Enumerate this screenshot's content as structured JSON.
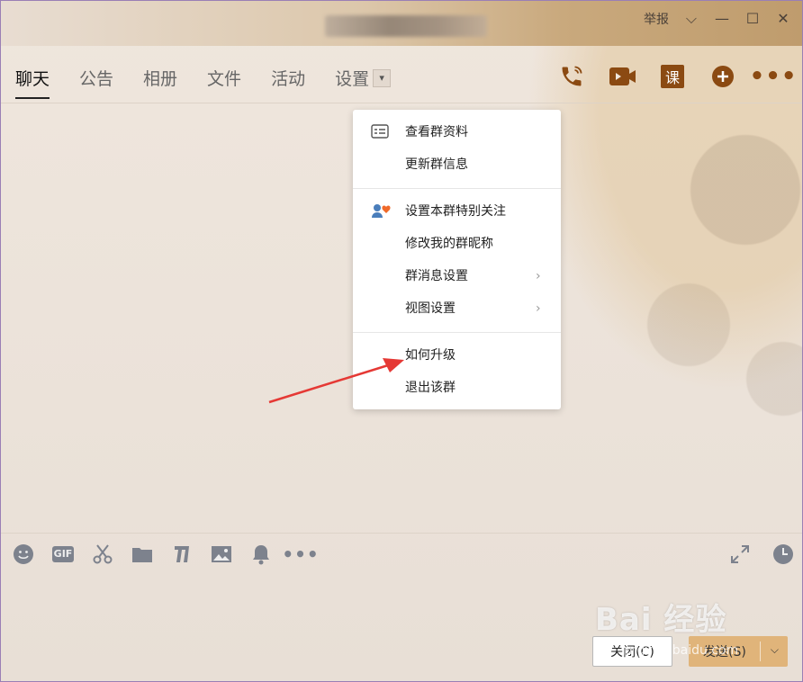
{
  "window": {
    "report_label": "举报",
    "controls": {
      "dropdown": "⌵",
      "minimize": "—",
      "maximize": "☐",
      "close": "✕"
    }
  },
  "tabs": [
    {
      "label": "聊天",
      "active": true
    },
    {
      "label": "公告"
    },
    {
      "label": "相册"
    },
    {
      "label": "文件"
    },
    {
      "label": "活动"
    },
    {
      "label": "设置"
    }
  ],
  "top_icons": [
    "phone-icon",
    "video-camera-icon",
    "course-icon",
    "add-icon",
    "more-icon"
  ],
  "top_icons_course_label": "课",
  "menu": {
    "items": [
      {
        "label": "查看群资料",
        "icon": "id-card-icon"
      },
      {
        "label": "更新群信息"
      },
      {
        "label": "设置本群特别关注",
        "icon": "special-care-icon"
      },
      {
        "label": "修改我的群昵称"
      },
      {
        "label": "群消息设置",
        "submenu": true
      },
      {
        "label": "视图设置",
        "submenu": true
      },
      {
        "label": "如何升级"
      },
      {
        "label": "退出该群"
      }
    ]
  },
  "toolbar": [
    "emoji-icon",
    "gif-icon",
    "screenshot-scissors-icon",
    "folder-icon",
    "music-icon",
    "image-icon",
    "bell-icon",
    "more-icon"
  ],
  "toolbar_gif_label": "GIF",
  "buttons": {
    "close_label": "关闭(C)",
    "send_label": "发送(S)"
  },
  "watermark": {
    "brand": "Bai 经验",
    "url": "jingyan.baidu.com"
  },
  "colors": {
    "accent": "#8b4a12",
    "send_button": "#e0b47a",
    "arrow": "#e53935"
  }
}
